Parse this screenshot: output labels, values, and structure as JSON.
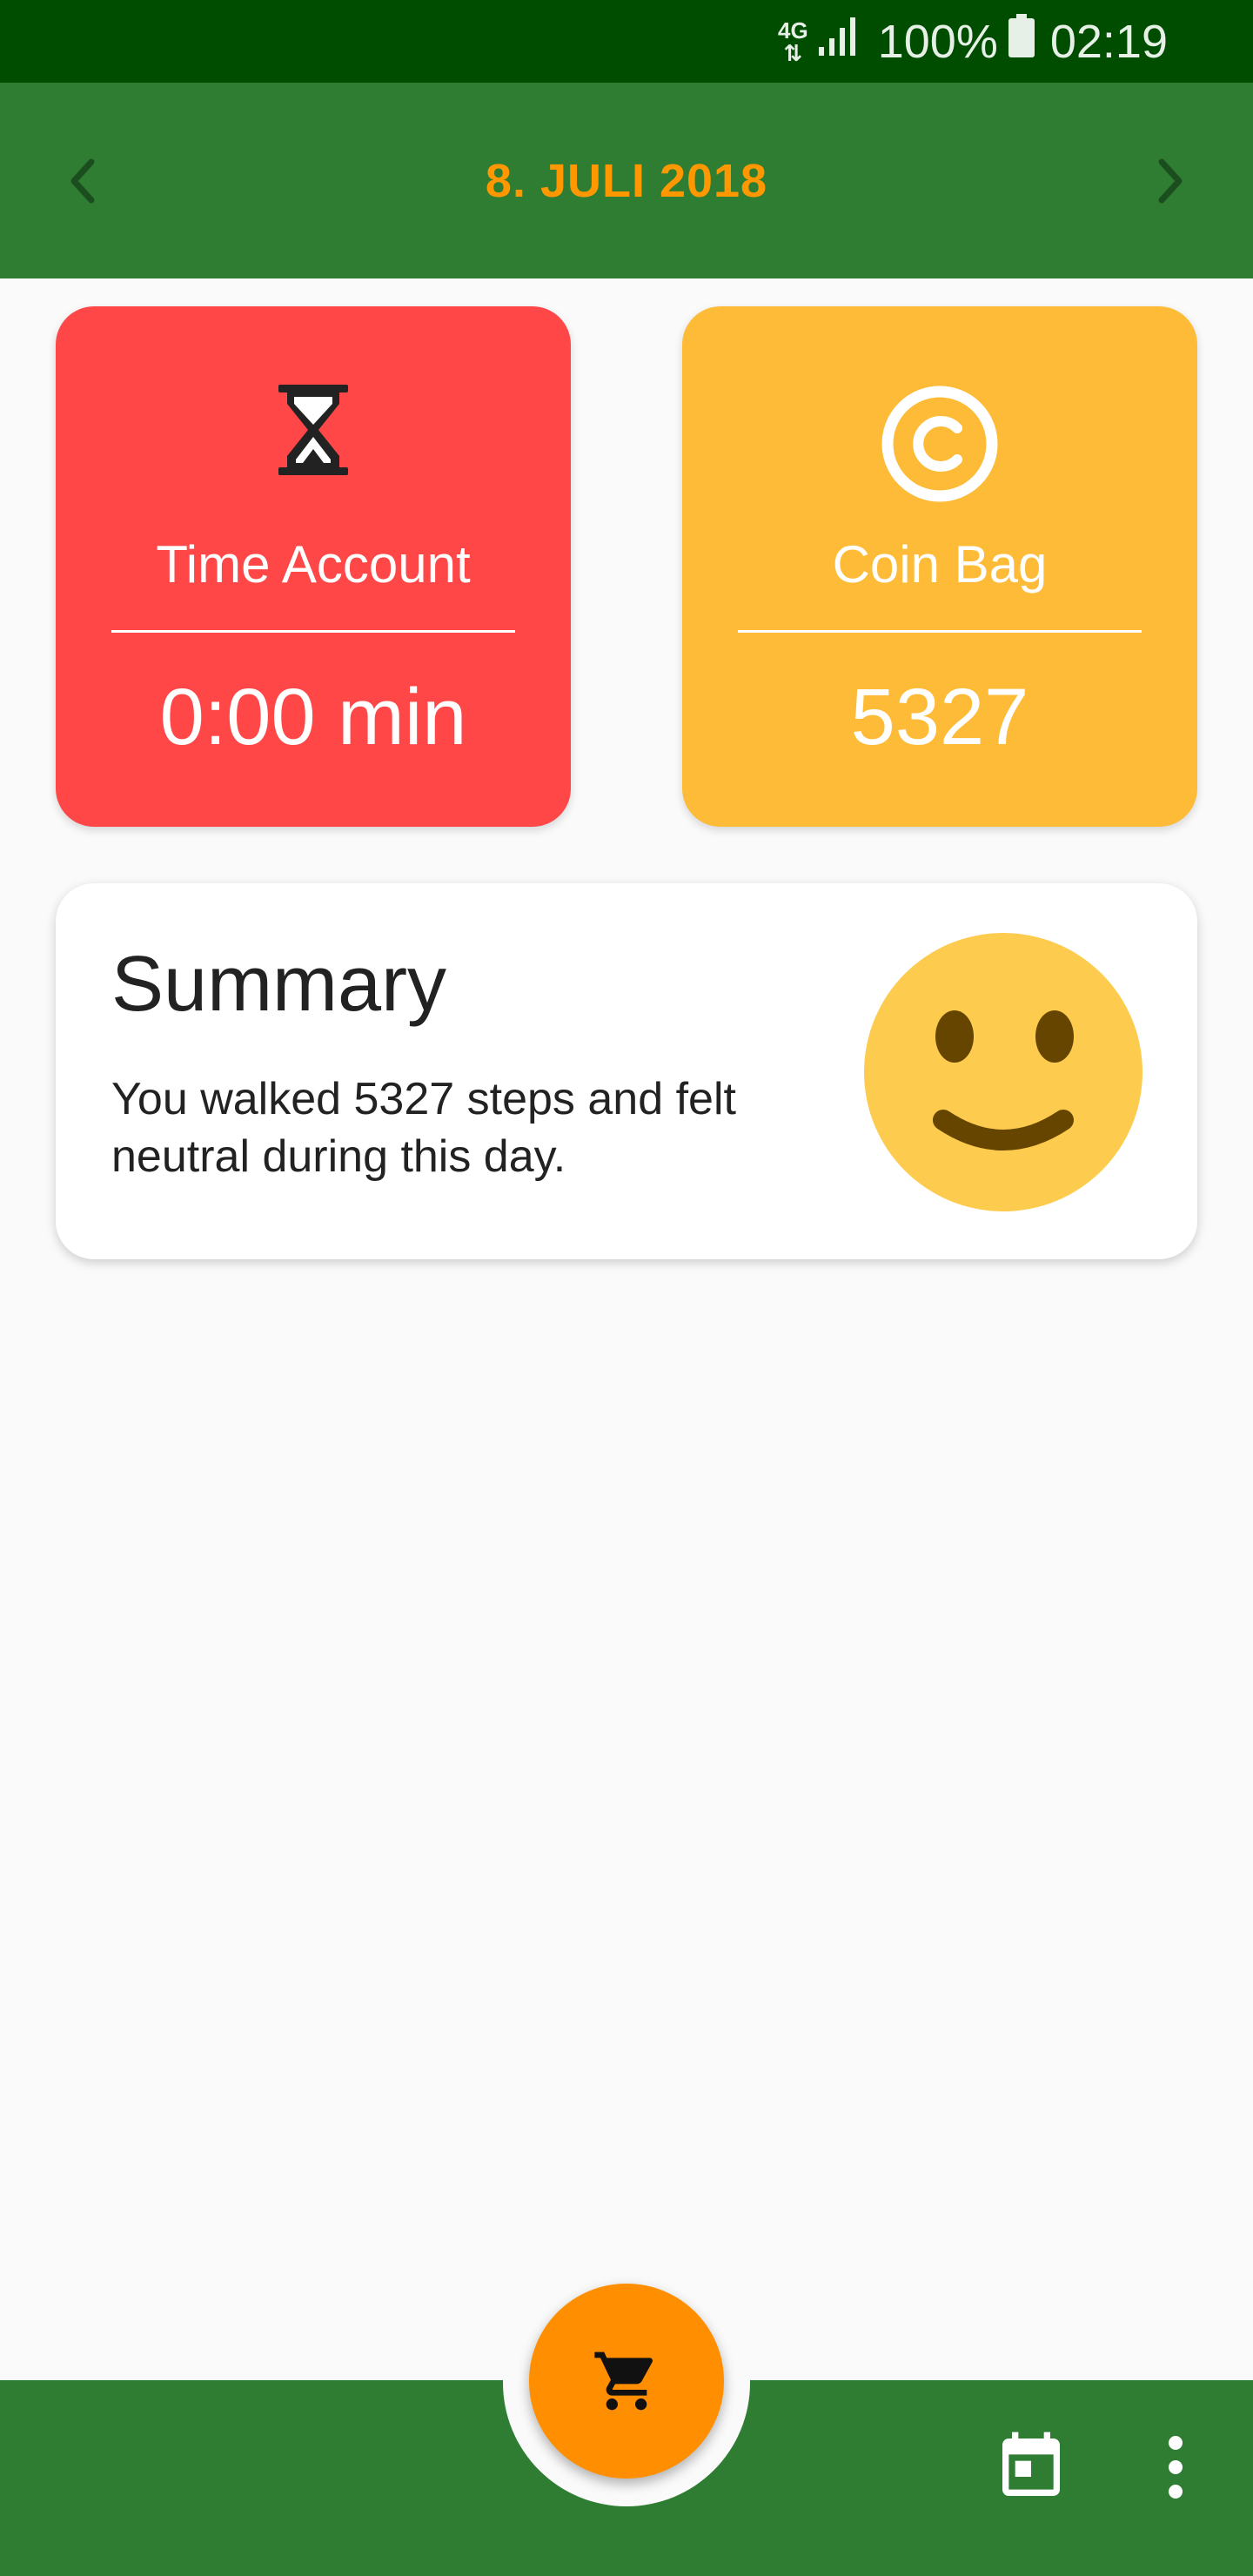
{
  "status_bar": {
    "network": "4G",
    "battery_percent": "100%",
    "time": "02:19"
  },
  "header": {
    "date": "8. JULI 2018",
    "prev_icon": "chevron-left-icon",
    "next_icon": "chevron-right-icon"
  },
  "cards": {
    "time_account": {
      "label": "Time Account",
      "value": "0:00 min",
      "icon": "hourglass-icon"
    },
    "coin_bag": {
      "label": "Coin Bag",
      "value": "5327",
      "icon": "copyright-coin-icon"
    }
  },
  "summary": {
    "title": "Summary",
    "text": "You walked 5327 steps and felt neutral during this day.",
    "mood_icon": "smiley-face-icon"
  },
  "bottom_bar": {
    "fab_icon": "shopping-cart-icon",
    "calendar_icon": "calendar-icon",
    "more_icon": "more-vert-icon"
  },
  "colors": {
    "status_bar": "#004d00",
    "app_bar": "#2e7d32",
    "accent_orange": "#ff9800",
    "time_card": "#ff4747",
    "coin_card": "#fdbb37",
    "fab": "#ff8f00"
  }
}
